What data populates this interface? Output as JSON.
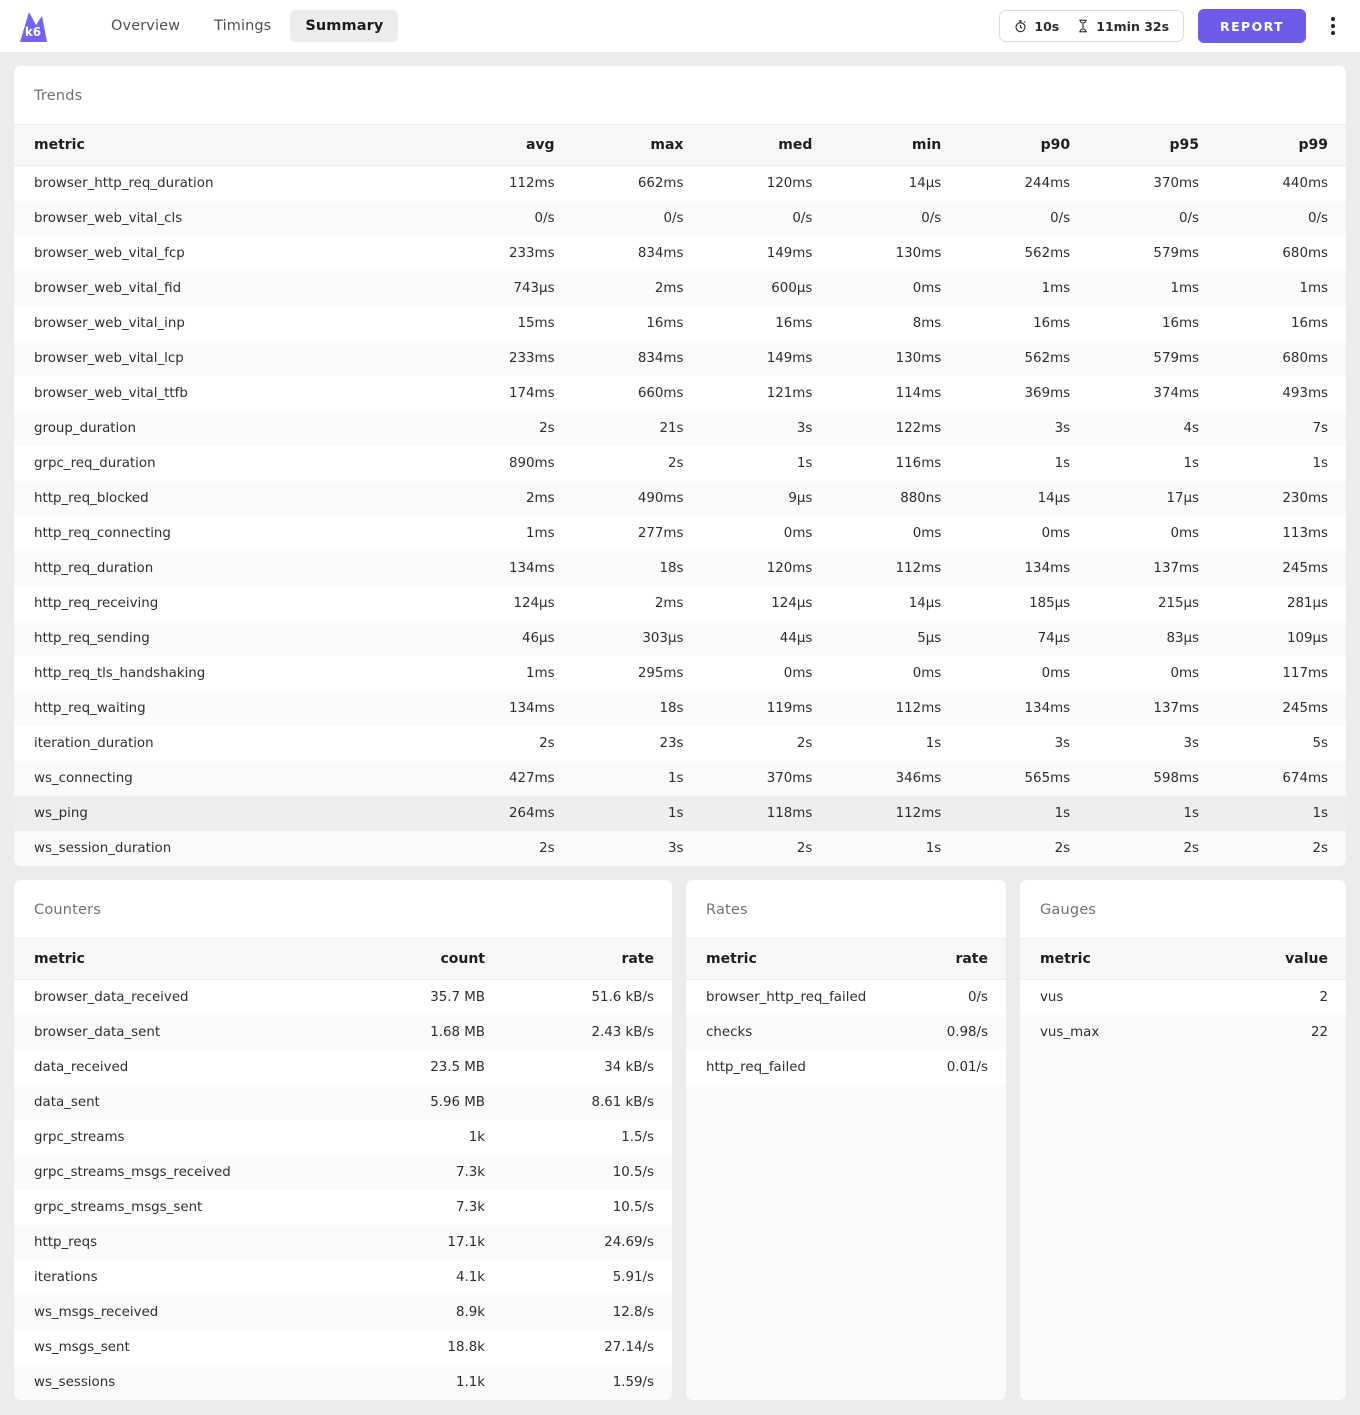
{
  "app": {
    "logo_text": "k6"
  },
  "nav": {
    "tabs": [
      {
        "label": "Overview",
        "active": false
      },
      {
        "label": "Timings",
        "active": false
      },
      {
        "label": "Summary",
        "active": true
      }
    ]
  },
  "toolbar": {
    "refresh_interval": "10s",
    "elapsed_time": "11min 32s",
    "report_label": "REPORT",
    "icons": {
      "refresh": "stopwatch-icon",
      "elapsed": "hourglass-icon",
      "menu": "kebab-menu-icon"
    },
    "accent_color": "#6c5ce7"
  },
  "trends": {
    "title": "Trends",
    "columns": [
      "metric",
      "avg",
      "max",
      "med",
      "min",
      "p90",
      "p95",
      "p99"
    ],
    "rows": [
      {
        "metric": "browser_http_req_duration",
        "avg": "112ms",
        "max": "662ms",
        "med": "120ms",
        "min": "14µs",
        "p90": "244ms",
        "p95": "370ms",
        "p99": "440ms",
        "hovered": false
      },
      {
        "metric": "browser_web_vital_cls",
        "avg": "0/s",
        "max": "0/s",
        "med": "0/s",
        "min": "0/s",
        "p90": "0/s",
        "p95": "0/s",
        "p99": "0/s",
        "hovered": false
      },
      {
        "metric": "browser_web_vital_fcp",
        "avg": "233ms",
        "max": "834ms",
        "med": "149ms",
        "min": "130ms",
        "p90": "562ms",
        "p95": "579ms",
        "p99": "680ms",
        "hovered": false
      },
      {
        "metric": "browser_web_vital_fid",
        "avg": "743µs",
        "max": "2ms",
        "med": "600µs",
        "min": "0ms",
        "p90": "1ms",
        "p95": "1ms",
        "p99": "1ms",
        "hovered": false
      },
      {
        "metric": "browser_web_vital_inp",
        "avg": "15ms",
        "max": "16ms",
        "med": "16ms",
        "min": "8ms",
        "p90": "16ms",
        "p95": "16ms",
        "p99": "16ms",
        "hovered": false
      },
      {
        "metric": "browser_web_vital_lcp",
        "avg": "233ms",
        "max": "834ms",
        "med": "149ms",
        "min": "130ms",
        "p90": "562ms",
        "p95": "579ms",
        "p99": "680ms",
        "hovered": false
      },
      {
        "metric": "browser_web_vital_ttfb",
        "avg": "174ms",
        "max": "660ms",
        "med": "121ms",
        "min": "114ms",
        "p90": "369ms",
        "p95": "374ms",
        "p99": "493ms",
        "hovered": false
      },
      {
        "metric": "group_duration",
        "avg": "2s",
        "max": "21s",
        "med": "3s",
        "min": "122ms",
        "p90": "3s",
        "p95": "4s",
        "p99": "7s",
        "hovered": false
      },
      {
        "metric": "grpc_req_duration",
        "avg": "890ms",
        "max": "2s",
        "med": "1s",
        "min": "116ms",
        "p90": "1s",
        "p95": "1s",
        "p99": "1s",
        "hovered": false
      },
      {
        "metric": "http_req_blocked",
        "avg": "2ms",
        "max": "490ms",
        "med": "9µs",
        "min": "880ns",
        "p90": "14µs",
        "p95": "17µs",
        "p99": "230ms",
        "hovered": false
      },
      {
        "metric": "http_req_connecting",
        "avg": "1ms",
        "max": "277ms",
        "med": "0ms",
        "min": "0ms",
        "p90": "0ms",
        "p95": "0ms",
        "p99": "113ms",
        "hovered": false
      },
      {
        "metric": "http_req_duration",
        "avg": "134ms",
        "max": "18s",
        "med": "120ms",
        "min": "112ms",
        "p90": "134ms",
        "p95": "137ms",
        "p99": "245ms",
        "hovered": false
      },
      {
        "metric": "http_req_receiving",
        "avg": "124µs",
        "max": "2ms",
        "med": "124µs",
        "min": "14µs",
        "p90": "185µs",
        "p95": "215µs",
        "p99": "281µs",
        "hovered": false
      },
      {
        "metric": "http_req_sending",
        "avg": "46µs",
        "max": "303µs",
        "med": "44µs",
        "min": "5µs",
        "p90": "74µs",
        "p95": "83µs",
        "p99": "109µs",
        "hovered": false
      },
      {
        "metric": "http_req_tls_handshaking",
        "avg": "1ms",
        "max": "295ms",
        "med": "0ms",
        "min": "0ms",
        "p90": "0ms",
        "p95": "0ms",
        "p99": "117ms",
        "hovered": false
      },
      {
        "metric": "http_req_waiting",
        "avg": "134ms",
        "max": "18s",
        "med": "119ms",
        "min": "112ms",
        "p90": "134ms",
        "p95": "137ms",
        "p99": "245ms",
        "hovered": false
      },
      {
        "metric": "iteration_duration",
        "avg": "2s",
        "max": "23s",
        "med": "2s",
        "min": "1s",
        "p90": "3s",
        "p95": "3s",
        "p99": "5s",
        "hovered": false
      },
      {
        "metric": "ws_connecting",
        "avg": "427ms",
        "max": "1s",
        "med": "370ms",
        "min": "346ms",
        "p90": "565ms",
        "p95": "598ms",
        "p99": "674ms",
        "hovered": false
      },
      {
        "metric": "ws_ping",
        "avg": "264ms",
        "max": "1s",
        "med": "118ms",
        "min": "112ms",
        "p90": "1s",
        "p95": "1s",
        "p99": "1s",
        "hovered": true
      },
      {
        "metric": "ws_session_duration",
        "avg": "2s",
        "max": "3s",
        "med": "2s",
        "min": "1s",
        "p90": "2s",
        "p95": "2s",
        "p99": "2s",
        "hovered": false
      }
    ]
  },
  "counters": {
    "title": "Counters",
    "columns": [
      "metric",
      "count",
      "rate"
    ],
    "rows": [
      {
        "metric": "browser_data_received",
        "count": "35.7 MB",
        "rate": "51.6 kB/s"
      },
      {
        "metric": "browser_data_sent",
        "count": "1.68 MB",
        "rate": "2.43 kB/s"
      },
      {
        "metric": "data_received",
        "count": "23.5 MB",
        "rate": "34 kB/s"
      },
      {
        "metric": "data_sent",
        "count": "5.96 MB",
        "rate": "8.61 kB/s"
      },
      {
        "metric": "grpc_streams",
        "count": "1k",
        "rate": "1.5/s"
      },
      {
        "metric": "grpc_streams_msgs_received",
        "count": "7.3k",
        "rate": "10.5/s"
      },
      {
        "metric": "grpc_streams_msgs_sent",
        "count": "7.3k",
        "rate": "10.5/s"
      },
      {
        "metric": "http_reqs",
        "count": "17.1k",
        "rate": "24.69/s"
      },
      {
        "metric": "iterations",
        "count": "4.1k",
        "rate": "5.91/s"
      },
      {
        "metric": "ws_msgs_received",
        "count": "8.9k",
        "rate": "12.8/s"
      },
      {
        "metric": "ws_msgs_sent",
        "count": "18.8k",
        "rate": "27.14/s"
      },
      {
        "metric": "ws_sessions",
        "count": "1.1k",
        "rate": "1.59/s"
      }
    ]
  },
  "rates": {
    "title": "Rates",
    "columns": [
      "metric",
      "rate"
    ],
    "rows": [
      {
        "metric": "browser_http_req_failed",
        "rate": "0/s"
      },
      {
        "metric": "checks",
        "rate": "0.98/s"
      },
      {
        "metric": "http_req_failed",
        "rate": "0.01/s"
      }
    ]
  },
  "gauges": {
    "title": "Gauges",
    "columns": [
      "metric",
      "value"
    ],
    "rows": [
      {
        "metric": "vus",
        "value": "2"
      },
      {
        "metric": "vus_max",
        "value": "22"
      }
    ]
  }
}
